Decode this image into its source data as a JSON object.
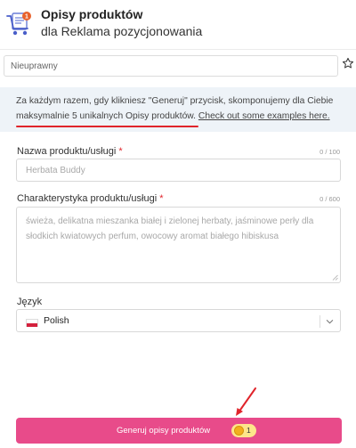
{
  "header": {
    "title": "Opisy produktów",
    "subtitle": "dla Reklama pozycjonowania",
    "badge": "1",
    "icon": "cart-document-icon"
  },
  "status": {
    "value": "Nieuprawny",
    "star_icon": "star-outline-icon"
  },
  "info": {
    "text_before": "Za każdym razem, gdy klikniesz \"Generuj\" przycisk, skomponujemy dla Ciebie ",
    "highlight": "maksymalnie 5 unikalnych Opisy produktów",
    "text_after": ". ",
    "link": "Check out some examples here."
  },
  "form": {
    "product_name": {
      "label": "Nazwa produktu/usługi",
      "required_mark": "*",
      "counter": "0 / 100",
      "placeholder": "Herbata Buddy"
    },
    "characteristics": {
      "label": "Charakterystyka produktu/usługi",
      "required_mark": "*",
      "counter": "0 / 600",
      "placeholder": "świeża, delikatna mieszanka białej i zielonej herbaty, jaśminowe perły dla słodkich kwiatowych perfum, owocowy aromat białego hibiskusa"
    },
    "language": {
      "label": "Język",
      "value": "Polish",
      "flag": "poland-flag-icon"
    }
  },
  "generate": {
    "label": "Generuj opisy produktów",
    "credits": "1",
    "coin_icon": "coin-icon"
  },
  "colors": {
    "accent": "#e84b8a",
    "required": "#e0242b",
    "info_bg": "#eef3f8"
  }
}
